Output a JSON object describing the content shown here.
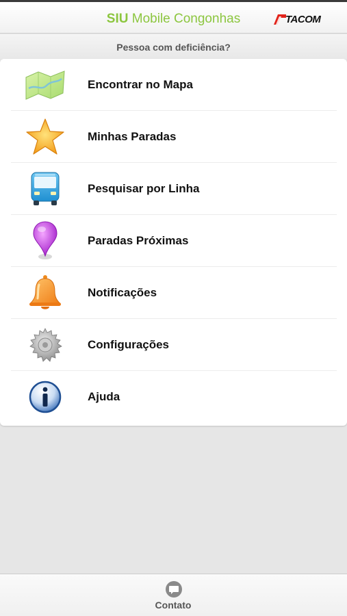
{
  "header": {
    "title_bold": "SIU",
    "title_rest": " Mobile Congonhas",
    "logo_text": "TACOM",
    "accent_color": "#8cc63f",
    "logo_color": "#e2231a"
  },
  "subheader": {
    "label": "Pessoa com deficiência?"
  },
  "menu": {
    "items": [
      {
        "label": "Encontrar no Mapa",
        "icon": "map-icon"
      },
      {
        "label": "Minhas Paradas",
        "icon": "star-icon"
      },
      {
        "label": "Pesquisar por Linha",
        "icon": "bus-icon"
      },
      {
        "label": "Paradas Próximas",
        "icon": "location-pin-icon"
      },
      {
        "label": "Notificações",
        "icon": "bell-icon"
      },
      {
        "label": "Configurações",
        "icon": "gear-icon"
      },
      {
        "label": "Ajuda",
        "icon": "info-icon"
      }
    ]
  },
  "footer": {
    "contact_label": "Contato",
    "contact_icon": "chat-bubble-icon"
  }
}
